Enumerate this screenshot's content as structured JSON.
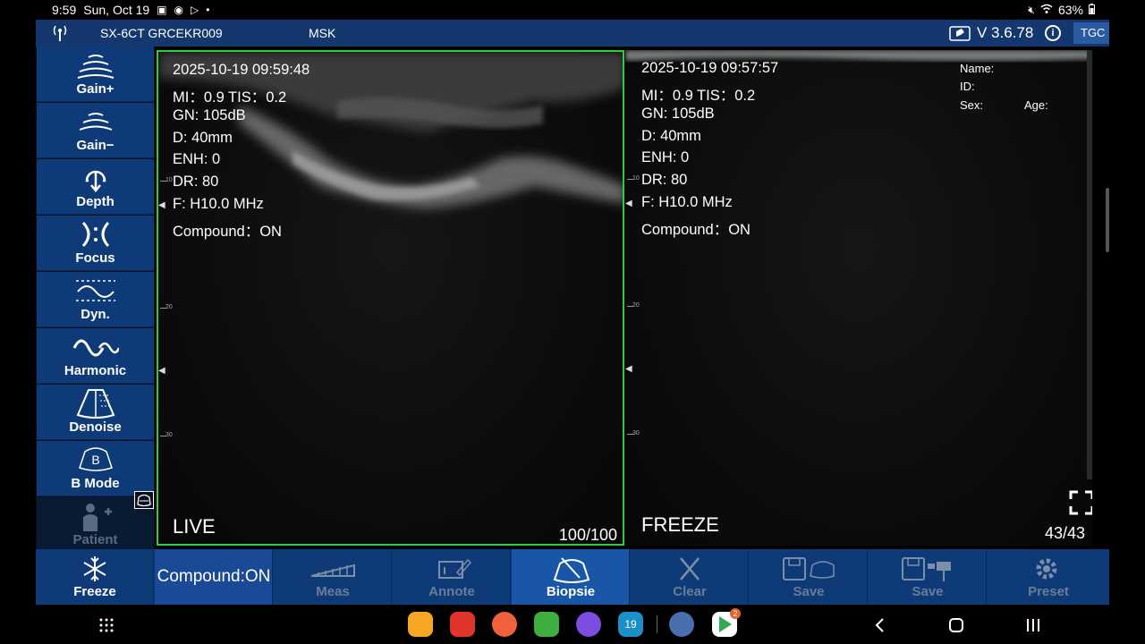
{
  "status_bar": {
    "time": "9:59",
    "date": "Sun, Oct 19",
    "battery": "63%"
  },
  "header": {
    "device": "SX-6CT GRCEKR009",
    "preset": "MSK",
    "version": "V 3.6.78",
    "info_glyph": "i",
    "tgc_label": "TGC <"
  },
  "sidebar": {
    "items": [
      {
        "label": "Gain+",
        "icon": "gain-plus-icon"
      },
      {
        "label": "Gain−",
        "icon": "gain-minus-icon"
      },
      {
        "label": "Depth",
        "icon": "depth-icon"
      },
      {
        "label": "Focus",
        "icon": "focus-icon"
      },
      {
        "label": "Dyn.",
        "icon": "dynamic-range-icon"
      },
      {
        "label": "Harmonic",
        "icon": "harmonic-icon"
      },
      {
        "label": "Denoise",
        "icon": "denoise-icon"
      },
      {
        "label": "B Mode",
        "icon": "b-mode-icon",
        "glyph": "B"
      },
      {
        "label": "Patient",
        "icon": "patient-icon",
        "disabled": true
      }
    ]
  },
  "left_pane": {
    "timestamp": "2025-10-19 09:59:48",
    "mi_tis": "MI：0.9  TIS：0.2",
    "gn": "GN: 105dB",
    "depth": "D: 40mm",
    "enh": "ENH: 0",
    "dr": "DR: 80",
    "freq": "F: H10.0 MHz",
    "compound": "Compound：ON",
    "state": "LIVE",
    "counter": "100/100"
  },
  "right_pane": {
    "timestamp": "2025-10-19 09:57:57",
    "mi_tis": "MI：0.9  TIS：0.2",
    "gn": "GN: 105dB",
    "depth": "D: 40mm",
    "enh": "ENH: 0",
    "dr": "DR: 80",
    "freq": "F: H10.0 MHz",
    "compound": "Compound：ON",
    "state": "FREEZE",
    "counter": "43/43",
    "patient": {
      "name_label": "Name:",
      "id_label": "ID:",
      "sex_label": "Sex:",
      "age_label": "Age:"
    }
  },
  "depth_scale": {
    "ticks": [
      "10",
      "20",
      "30"
    ]
  },
  "toolbar": {
    "freeze": "Freeze",
    "compound": "Compound:ON",
    "meas": "Meas",
    "annote": "Annote",
    "biopsie": "Biopsie",
    "clear": "Clear",
    "save_image": "Save",
    "save_video": "Save",
    "preset": "Preset"
  },
  "dock": {
    "calendar_day": "19",
    "play_badge": "2"
  },
  "colors": {
    "header_bg": "#14386e",
    "button_bg": "#0f3a78",
    "active_frame": "#2ecc40",
    "active_button": "#1a56a8"
  }
}
